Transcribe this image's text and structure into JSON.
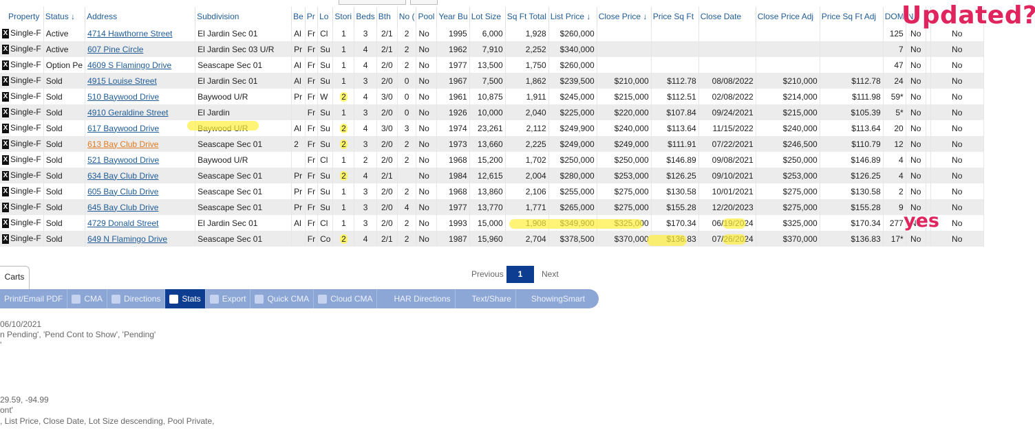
{
  "columns": [
    "Property",
    "Status",
    "Address",
    "Subdivision",
    "Be",
    "Pr",
    "Lo",
    "Stori",
    "Beds",
    "Bth",
    "No (",
    "Pool",
    "Year Bu",
    "Lot Size",
    "Sq Ft Total",
    "List Price",
    "Close Price",
    "Price Sq Ft",
    "Close Date",
    "Close Price Adj",
    "Price Sq Ft Adj",
    "DOM",
    "Nc",
    "",
    ""
  ],
  "rows": [
    {
      "type": "Single-F",
      "status": "Active",
      "address": "4714 Hawthorne Street",
      "subdivision": "El Jardin Sec 01",
      "be": "Al",
      "pr": "Fr",
      "lo": "Cl",
      "stories": "1",
      "beds": "3",
      "bth": "2/1",
      "no": "2",
      "pool": "No",
      "year": "1995",
      "lot": "6,000",
      "sqft": "1,928",
      "list": "$260,000",
      "close": "",
      "ppsf": "",
      "date": "",
      "close_adj": "",
      "ppsf_adj": "",
      "dom": "125",
      "c1": "No",
      "c2": "No"
    },
    {
      "type": "Single-F",
      "status": "Active",
      "address": "607 Pine Circle",
      "subdivision": "El Jardin Sec 03 U/R",
      "be": "Pr",
      "pr": "Fr",
      "lo": "Su",
      "stories": "1",
      "beds": "4",
      "bth": "2/1",
      "no": "2",
      "pool": "No",
      "year": "1962",
      "lot": "7,910",
      "sqft": "2,252",
      "list": "$340,000",
      "close": "",
      "ppsf": "",
      "date": "",
      "close_adj": "",
      "ppsf_adj": "",
      "dom": "7",
      "c1": "No",
      "c2": "No"
    },
    {
      "type": "Single-F",
      "status": "Option Pe",
      "address": "4609 S Flamingo Drive",
      "subdivision": "Seascape Sec 01",
      "be": "Al",
      "pr": "Fr",
      "lo": "Su",
      "stories": "1",
      "beds": "4",
      "bth": "2/0",
      "no": "2",
      "pool": "No",
      "year": "1977",
      "lot": "13,500",
      "sqft": "1,750",
      "list": "$260,000",
      "close": "",
      "ppsf": "",
      "date": "",
      "close_adj": "",
      "ppsf_adj": "",
      "dom": "47",
      "c1": "No",
      "c2": "No"
    },
    {
      "type": "Single-F",
      "status": "Sold",
      "address": "4915 Louise Street",
      "subdivision": "El Jardin Sec 01",
      "be": "Al",
      "pr": "Fr",
      "lo": "Su",
      "stories": "1",
      "beds": "3",
      "bth": "2/0",
      "no": "0",
      "pool": "No",
      "year": "1967",
      "lot": "7,500",
      "sqft": "1,862",
      "list": "$239,500",
      "close": "$210,000",
      "ppsf": "$112.78",
      "date": "08/08/2022",
      "close_adj": "$210,000",
      "ppsf_adj": "$112.78",
      "dom": "24",
      "c1": "No",
      "c2": "No"
    },
    {
      "type": "Single-F",
      "status": "Sold",
      "address": "510 Baywood Drive",
      "subdivision": "Baywood U/R",
      "be": "Pr",
      "pr": "Fr",
      "lo": "W",
      "stories": "2",
      "beds": "4",
      "bth": "3/0",
      "no": "0",
      "pool": "No",
      "year": "1961",
      "lot": "10,875",
      "sqft": "1,911",
      "list": "$245,000",
      "close": "$215,000",
      "ppsf": "$112.51",
      "date": "02/08/2022",
      "close_adj": "$214,000",
      "ppsf_adj": "$111.98",
      "dom": "59*",
      "c1": "No",
      "c2": "No"
    },
    {
      "type": "Single-F",
      "status": "Sold",
      "address": "4910 Geraldine Street",
      "subdivision": "El Jardin",
      "be": "",
      "pr": "Fr",
      "lo": "Su",
      "stories": "1",
      "beds": "3",
      "bth": "2/0",
      "no": "0",
      "pool": "No",
      "year": "1926",
      "lot": "10,000",
      "sqft": "2,040",
      "list": "$225,000",
      "close": "$220,000",
      "ppsf": "$107.84",
      "date": "09/24/2021",
      "close_adj": "$215,000",
      "ppsf_adj": "$105.39",
      "dom": "5*",
      "c1": "No",
      "c2": "No"
    },
    {
      "type": "Single-F",
      "status": "Sold",
      "address": "617 Baywood Drive",
      "subdivision": "Baywood U/R",
      "be": "Al",
      "pr": "Fr",
      "lo": "Su",
      "stories": "2",
      "beds": "4",
      "bth": "3/0",
      "no": "3",
      "pool": "No",
      "year": "1974",
      "lot": "23,261",
      "sqft": "2,112",
      "list": "$249,900",
      "close": "$240,000",
      "ppsf": "$113.64",
      "date": "11/15/2022",
      "close_adj": "$240,000",
      "ppsf_adj": "$113.64",
      "dom": "20",
      "c1": "No",
      "c2": "No"
    },
    {
      "type": "Single-F",
      "status": "Sold",
      "address": "613 Bay Club Drive",
      "subdivision": "Seascape Sec 01",
      "be": "2",
      "pr": "Fr",
      "lo": "Su",
      "stories": "2",
      "beds": "3",
      "bth": "2/0",
      "no": "2",
      "pool": "No",
      "year": "1973",
      "lot": "13,660",
      "sqft": "2,225",
      "list": "$249,000",
      "close": "$249,000",
      "ppsf": "$111.91",
      "date": "07/22/2021",
      "close_adj": "$246,500",
      "ppsf_adj": "$110.79",
      "dom": "12",
      "c1": "No",
      "c2": "No"
    },
    {
      "type": "Single-F",
      "status": "Sold",
      "address": "521 Baywood Drive",
      "subdivision": "Baywood U/R",
      "be": "",
      "pr": "Fr",
      "lo": "Cl",
      "stories": "1",
      "beds": "2",
      "bth": "2/0",
      "no": "2",
      "pool": "No",
      "year": "1968",
      "lot": "15,200",
      "sqft": "1,702",
      "list": "$250,000",
      "close": "$250,000",
      "ppsf": "$146.89",
      "date": "09/08/2021",
      "close_adj": "$250,000",
      "ppsf_adj": "$146.89",
      "dom": "4",
      "c1": "No",
      "c2": "No"
    },
    {
      "type": "Single-F",
      "status": "Sold",
      "address": "634 Bay Club Drive",
      "subdivision": "Seascape Sec 01",
      "be": "Pr",
      "pr": "Fr",
      "lo": "Su",
      "stories": "2",
      "beds": "4",
      "bth": "2/1",
      "no": "",
      "pool": "No",
      "year": "1984",
      "lot": "12,615",
      "sqft": "2,004",
      "list": "$280,000",
      "close": "$253,000",
      "ppsf": "$126.25",
      "date": "09/10/2021",
      "close_adj": "$253,000",
      "ppsf_adj": "$126.25",
      "dom": "4",
      "c1": "No",
      "c2": "No"
    },
    {
      "type": "Single-F",
      "status": "Sold",
      "address": "605 Bay Club Drive",
      "subdivision": "Seascape Sec 01",
      "be": "Pr",
      "pr": "Fr",
      "lo": "Su",
      "stories": "1",
      "beds": "3",
      "bth": "2/0",
      "no": "2",
      "pool": "No",
      "year": "1968",
      "lot": "13,860",
      "sqft": "2,106",
      "list": "$255,000",
      "close": "$275,000",
      "ppsf": "$130.58",
      "date": "10/01/2021",
      "close_adj": "$275,000",
      "ppsf_adj": "$130.58",
      "dom": "2",
      "c1": "No",
      "c2": "No"
    },
    {
      "type": "Single-F",
      "status": "Sold",
      "address": "645 Bay Club Drive",
      "subdivision": "Seascape Sec 01",
      "be": "Pr",
      "pr": "Fr",
      "lo": "Su",
      "stories": "1",
      "beds": "3",
      "bth": "2/0",
      "no": "4",
      "pool": "No",
      "year": "1977",
      "lot": "13,770",
      "sqft": "1,771",
      "list": "$265,000",
      "close": "$275,000",
      "ppsf": "$155.28",
      "date": "12/20/2023",
      "close_adj": "$275,000",
      "ppsf_adj": "$155.28",
      "dom": "9",
      "c1": "No",
      "c2": "No"
    },
    {
      "type": "Single-F",
      "status": "Sold",
      "address": "4729 Donald Street",
      "subdivision": "El Jardin Sec 01",
      "be": "Al",
      "pr": "Fr",
      "lo": "Cl",
      "stories": "1",
      "beds": "3",
      "bth": "2/0",
      "no": "2",
      "pool": "No",
      "year": "1993",
      "lot": "15,000",
      "sqft": "1,908",
      "list": "$349,900",
      "close": "$325,000",
      "ppsf": "$170.34",
      "date": "06/19/2024",
      "close_adj": "$325,000",
      "ppsf_adj": "$170.34",
      "dom": "277",
      "c1": "No",
      "c2": "No"
    },
    {
      "type": "Single-F",
      "status": "Sold",
      "address": "649 N Flamingo Drive",
      "subdivision": "Seascape Sec 01",
      "be": "",
      "pr": "Fr",
      "lo": "Co",
      "stories": "2",
      "beds": "4",
      "bth": "2/1",
      "no": "2",
      "pool": "No",
      "year": "1987",
      "lot": "15,960",
      "sqft": "2,704",
      "list": "$378,500",
      "close": "$370,000",
      "ppsf": "$136.83",
      "date": "07/26/2024",
      "close_adj": "$370,000",
      "ppsf_adj": "$136.83",
      "dom": "17*",
      "c1": "No",
      "c2": "No"
    }
  ],
  "annotations": {
    "updated": "Updated?",
    "yes": "yes"
  },
  "pagination": {
    "carts_tab": "Carts",
    "previous": "Previous",
    "current": "1",
    "next": "Next"
  },
  "toolbar": [
    "Print/Email PDF",
    "CMA",
    "Directions",
    "Stats",
    "Export",
    "Quick CMA",
    "Cloud CMA",
    "HAR Directions",
    "Text/Share",
    "ShowingSmart"
  ],
  "toolbar_active": "Stats",
  "criteria": [
    "06/10/2021",
    "n Pending', 'Pend Cont to Show', 'Pending'",
    "'",
    "29.59, -94.99",
    "ont'",
    ", List Price, Close Date, Lot Size descending, Pool Private,"
  ],
  "colors": {
    "link": "#1f5c99",
    "visited_link": "#e07a1f",
    "annotation": "#e0245e",
    "highlight": "#fff03c",
    "toolbar": "#8ca6d6",
    "toolbar_active": "#0d3d91"
  }
}
